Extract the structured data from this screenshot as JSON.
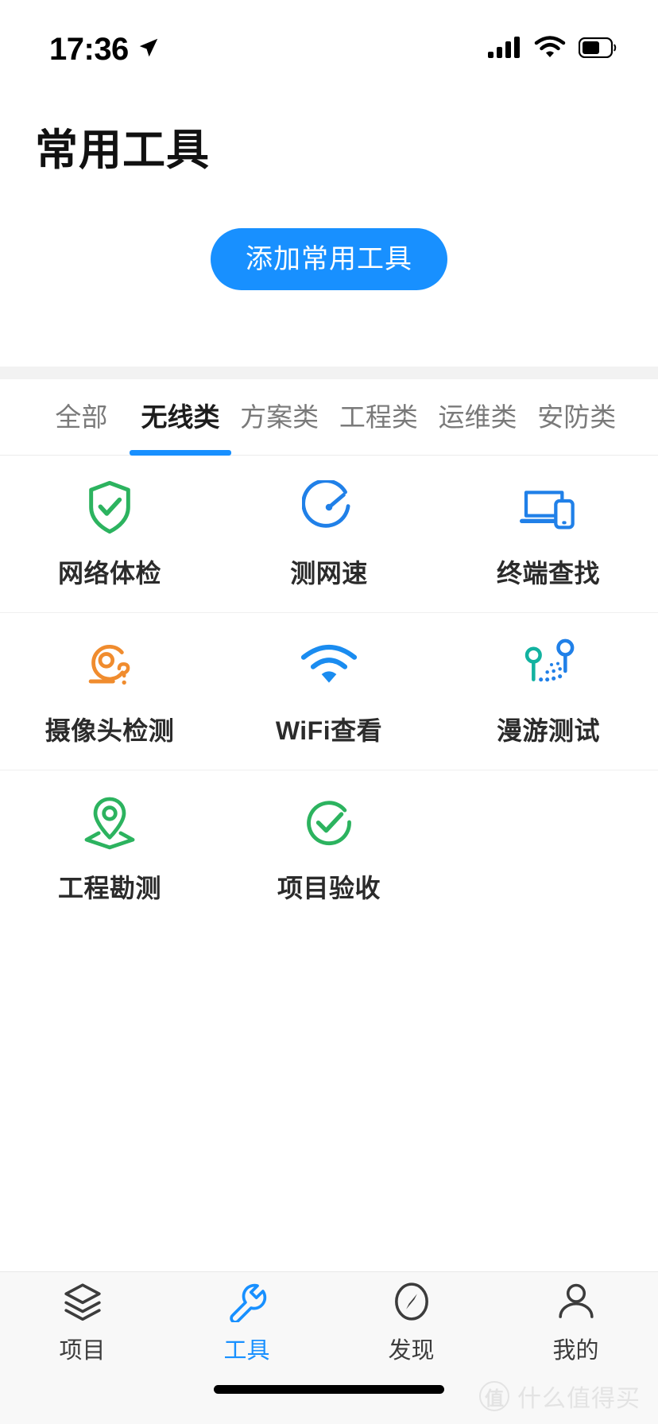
{
  "status_bar": {
    "time": "17:36",
    "location_icon": "location-arrow-icon",
    "signal_icon": "cellular-signal-icon",
    "wifi_icon": "wifi-icon",
    "battery_icon": "battery-icon"
  },
  "header": {
    "title": "常用工具"
  },
  "add_button": {
    "label": "添加常用工具",
    "color": "#1890ff"
  },
  "tabs": {
    "active_index": 1,
    "items": [
      {
        "label": "全部"
      },
      {
        "label": "无线类"
      },
      {
        "label": "方案类"
      },
      {
        "label": "工程类"
      },
      {
        "label": "运维类"
      },
      {
        "label": "安防类"
      }
    ],
    "indicator_color": "#1890ff"
  },
  "tools": {
    "rows": [
      [
        {
          "label": "网络体检",
          "icon": "shield-check-icon",
          "color": "#2cb35f"
        },
        {
          "label": "测网速",
          "icon": "speedometer-icon",
          "color": "#2080e8"
        },
        {
          "label": "终端查找",
          "icon": "laptop-phone-icon",
          "color": "#2080e8"
        }
      ],
      [
        {
          "label": "摄像头检测",
          "icon": "camera-lens-question-icon",
          "color": "#f08c2e"
        },
        {
          "label": "WiFi查看",
          "icon": "wifi-signal-icon",
          "color": "#1a8cf0"
        },
        {
          "label": "漫游测试",
          "icon": "roaming-pins-icon",
          "color": "#2080e8"
        }
      ],
      [
        {
          "label": "工程勘测",
          "icon": "map-pin-survey-icon",
          "color": "#2cb35f"
        },
        {
          "label": "项目验收",
          "icon": "circle-check-icon",
          "color": "#2cb35f"
        },
        {
          "label": "",
          "icon": "",
          "color": ""
        }
      ]
    ]
  },
  "bottom_nav": {
    "active_index": 1,
    "items": [
      {
        "label": "项目",
        "icon": "layers-icon"
      },
      {
        "label": "工具",
        "icon": "wrench-icon"
      },
      {
        "label": "发现",
        "icon": "compass-icon"
      },
      {
        "label": "我的",
        "icon": "person-icon"
      }
    ],
    "active_color": "#1890ff"
  },
  "watermark": {
    "badge": "值",
    "text": "什么值得买"
  }
}
